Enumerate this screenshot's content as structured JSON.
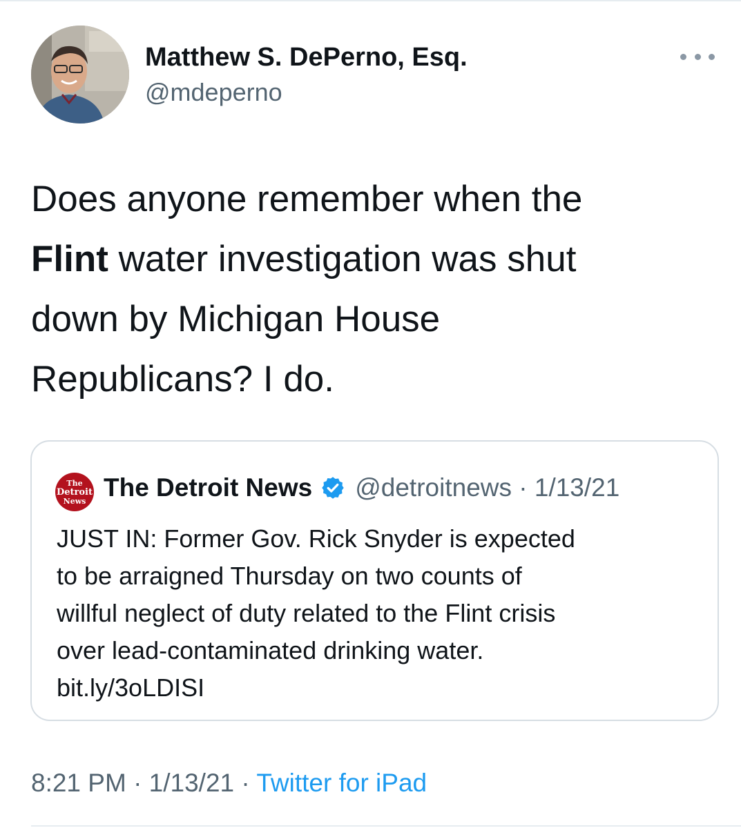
{
  "author": {
    "name": "Matthew S. DePerno, Esq.",
    "handle": "@mdeperno"
  },
  "tweet": {
    "lines": [
      {
        "pre": "Does anyone remember when the",
        "bold": "",
        "post": ""
      },
      {
        "pre": "",
        "bold": "Flint",
        "post": " water investigation was shut"
      },
      {
        "pre": "down by Michigan House",
        "bold": "",
        "post": ""
      },
      {
        "pre": "Republicans? I do.",
        "bold": "",
        "post": ""
      }
    ]
  },
  "quoted": {
    "logo": {
      "top": "The",
      "mid": "Detroit",
      "bottom": "News"
    },
    "name": "The Detroit News",
    "verified_icon": "verified-badge-icon",
    "handle_date": "@detroitnews · 1/13/21",
    "lines": [
      "JUST IN: Former Gov. Rick Snyder is expected",
      "to be arraigned Thursday on two counts of",
      "willful neglect of duty related to the Flint crisis",
      "over lead-contaminated drinking water.",
      "bit.ly/3oLDISI"
    ]
  },
  "footer": {
    "time_date": "8:21 PM · 1/13/21 · ",
    "source": "Twitter for iPad"
  },
  "colors": {
    "text": "#0f1419",
    "secondary": "#536471",
    "link": "#1d9bf0",
    "detroit_red": "#b3121e"
  }
}
